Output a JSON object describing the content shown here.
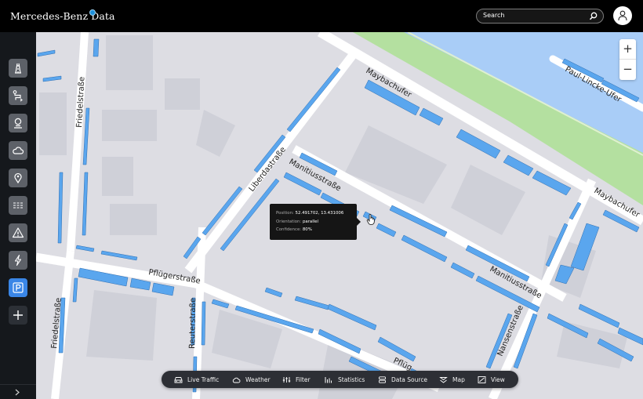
{
  "header": {
    "brand": "Mercedes-Benz Data",
    "search_placeholder": "Search"
  },
  "sidebar": {
    "items": [
      {
        "name": "road-icon"
      },
      {
        "name": "route-icon"
      },
      {
        "name": "location-person-icon"
      },
      {
        "name": "weather-cloud-icon"
      },
      {
        "name": "map-pin-icon"
      },
      {
        "name": "traffic-lanes-icon"
      },
      {
        "name": "warning-icon"
      },
      {
        "name": "charging-bolt-icon"
      },
      {
        "name": "parking-icon",
        "active": true
      },
      {
        "name": "add-icon"
      }
    ],
    "expand_icon": "chevron-right-icon"
  },
  "map": {
    "zoom_in": "+",
    "zoom_out": "−",
    "labels": {
      "maybachufer_top": "Maybachufer",
      "maybachufer_right": "Maybachufer",
      "paul_lincke": "Paul-Lincke-Ufer",
      "friedelstrasse_top": "Friedelstraße",
      "friedelstrasse_bottom": "Friedelstraße",
      "liberdastrasse": "Liberdastraße",
      "manitiusstrasse_left": "Manitiusstraße",
      "manitiusstrasse_right": "Manitiusstraße",
      "pfluegerstrasse_left": "Pflügerstraße",
      "pfluegerstrasse_right": "Pflüg",
      "reuterstrasse": "Reuterstraße",
      "nansenstrasse": "Nansenstraße"
    },
    "colors": {
      "background": "#dddde3",
      "road": "#ffffff",
      "water": "#a9cdf7",
      "park": "#b4e0a0",
      "parking": "#5aa6ee"
    }
  },
  "tooltip": {
    "position_label": "Position:",
    "position_value": "52.491702, 13.431006",
    "orientation_label": "Orientation:",
    "orientation_value": "parallel",
    "confidence_label": "Confidence:",
    "confidence_value": "80%"
  },
  "toolbar": {
    "items": [
      {
        "label": "Live Traffic",
        "icon": "car-icon"
      },
      {
        "label": "Weather",
        "icon": "cloud-icon"
      },
      {
        "label": "Filter",
        "icon": "sliders-icon"
      },
      {
        "label": "Statistics",
        "icon": "bar-chart-icon"
      },
      {
        "label": "Data Source",
        "icon": "database-icon"
      },
      {
        "label": "Map",
        "icon": "layers-icon"
      },
      {
        "label": "View",
        "icon": "view-icon"
      }
    ]
  }
}
